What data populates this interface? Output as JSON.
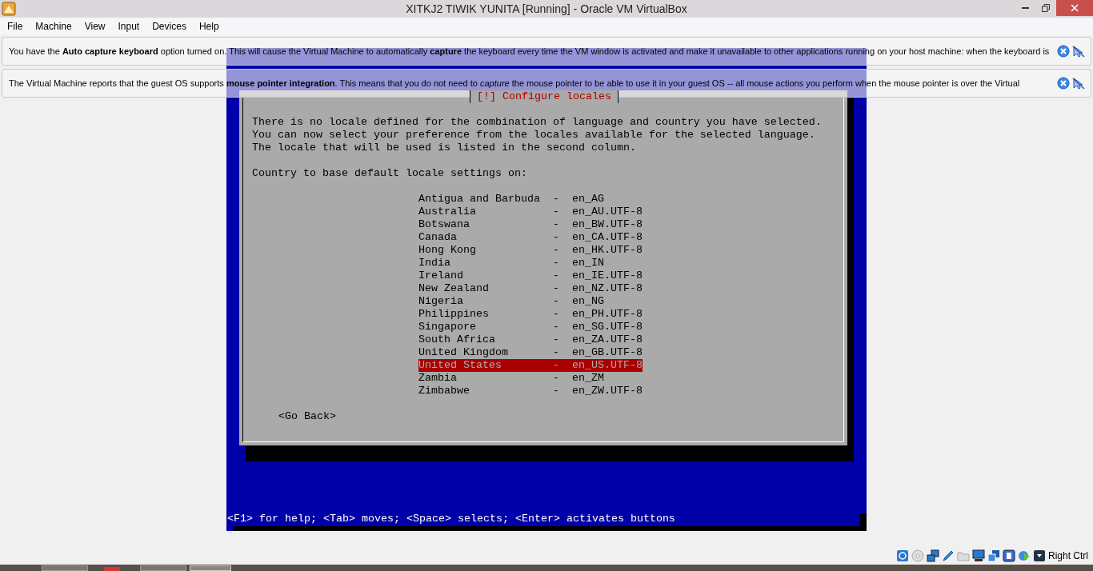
{
  "window": {
    "title": "XITKJ2 TIWIK YUNITA [Running] - Oracle VM VirtualBox"
  },
  "menu": [
    "File",
    "Machine",
    "View",
    "Input",
    "Devices",
    "Help"
  ],
  "notifications": [
    {
      "text": "You have the **Auto capture keyboard** option turned on. This will cause the Virtual Machine to automatically **capture** the keyboard every time the VM window is activated and make it unavailable to other applications running on your host machine: when the keyboard is"
    },
    {
      "text": "The Virtual Machine reports that the guest OS supports **mouse pointer integration**. This means that you do not need to *capture* the mouse pointer to be able to use it in your guest OS -- all mouse actions you perform when the mouse pointer is over the Virtual"
    }
  ],
  "dialog": {
    "title": "[!] Configure locales",
    "paragraph": [
      "There is no locale defined for the combination of language and country you have selected.",
      "You can now select your preference from the locales available for the selected language.",
      "The locale that will be used is listed in the second column."
    ],
    "prompt": "Country to base default locale settings on:",
    "locales": [
      {
        "country": "Antigua and Barbuda",
        "dash": "-",
        "locale": "en_AG",
        "selected": false
      },
      {
        "country": "Australia",
        "dash": "-",
        "locale": "en_AU.UTF-8",
        "selected": false
      },
      {
        "country": "Botswana",
        "dash": "-",
        "locale": "en_BW.UTF-8",
        "selected": false
      },
      {
        "country": "Canada",
        "dash": "-",
        "locale": "en_CA.UTF-8",
        "selected": false
      },
      {
        "country": "Hong Kong",
        "dash": "-",
        "locale": "en_HK.UTF-8",
        "selected": false
      },
      {
        "country": "India",
        "dash": "-",
        "locale": "en_IN",
        "selected": false
      },
      {
        "country": "Ireland",
        "dash": "-",
        "locale": "en_IE.UTF-8",
        "selected": false
      },
      {
        "country": "New Zealand",
        "dash": "-",
        "locale": "en_NZ.UTF-8",
        "selected": false
      },
      {
        "country": "Nigeria",
        "dash": "-",
        "locale": "en_NG",
        "selected": false
      },
      {
        "country": "Philippines",
        "dash": "-",
        "locale": "en_PH.UTF-8",
        "selected": false
      },
      {
        "country": "Singapore",
        "dash": "-",
        "locale": "en_SG.UTF-8",
        "selected": false
      },
      {
        "country": "South Africa",
        "dash": "-",
        "locale": "en_ZA.UTF-8",
        "selected": false
      },
      {
        "country": "United Kingdom",
        "dash": "-",
        "locale": "en_GB.UTF-8",
        "selected": false
      },
      {
        "country": "United States",
        "dash": "-",
        "locale": "en_US.UTF-8",
        "selected": true
      },
      {
        "country": "Zambia",
        "dash": "-",
        "locale": "en_ZM",
        "selected": false
      },
      {
        "country": "Zimbabwe",
        "dash": "-",
        "locale": "en_ZW.UTF-8",
        "selected": false
      }
    ],
    "go_back": "<Go Back>"
  },
  "help_line": "<F1> for help; <Tab> moves; <Space> selects; <Enter> activates buttons",
  "status_bar": {
    "host_key": "Right Ctrl"
  }
}
